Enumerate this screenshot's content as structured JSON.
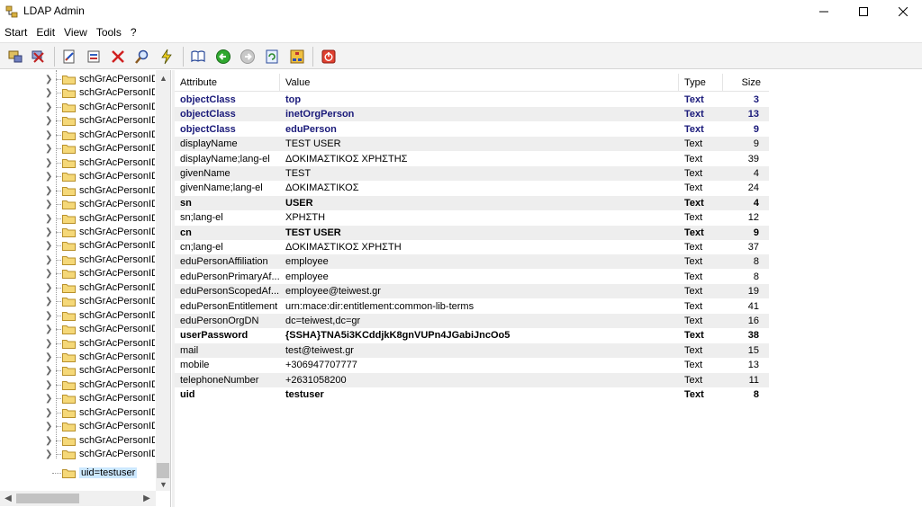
{
  "window": {
    "title": "LDAP Admin"
  },
  "menu": [
    "Start",
    "Edit",
    "View",
    "Tools",
    "?"
  ],
  "tree": {
    "items": [
      "schGrAcPersonID=",
      "schGrAcPersonID=",
      "schGrAcPersonID=",
      "schGrAcPersonID=",
      "schGrAcPersonID=",
      "schGrAcPersonID=",
      "schGrAcPersonID=",
      "schGrAcPersonID=",
      "schGrAcPersonID=",
      "schGrAcPersonID=",
      "schGrAcPersonID=",
      "schGrAcPersonID=",
      "schGrAcPersonID=",
      "schGrAcPersonID=",
      "schGrAcPersonID=",
      "schGrAcPersonID=",
      "schGrAcPersonID=",
      "schGrAcPersonID=",
      "schGrAcPersonID=",
      "schGrAcPersonID=",
      "schGrAcPersonID=",
      "schGrAcPersonID=",
      "schGrAcPersonID=",
      "schGrAcPersonID=",
      "schGrAcPersonID=",
      "schGrAcPersonID=",
      "schGrAcPersonID=",
      "schGrAcPersonID="
    ],
    "selected": "uid=testuser"
  },
  "list": {
    "headers": {
      "attribute": "Attribute",
      "value": "Value",
      "type": "Type",
      "size": "Size"
    },
    "rows": [
      {
        "attribute": "objectClass",
        "value": "top",
        "type": "Text",
        "size": "3",
        "style": "objclass"
      },
      {
        "attribute": "objectClass",
        "value": "inetOrgPerson",
        "type": "Text",
        "size": "13",
        "style": "objclass"
      },
      {
        "attribute": "objectClass",
        "value": "eduPerson",
        "type": "Text",
        "size": "9",
        "style": "objclass"
      },
      {
        "attribute": "displayName",
        "value": "TEST USER",
        "type": "Text",
        "size": "9",
        "style": ""
      },
      {
        "attribute": "displayName;lang-el",
        "value": "ΔΟΚΙΜΑΣΤΙΚΟΣ ΧΡΗΣΤΗΣ",
        "type": "Text",
        "size": "39",
        "style": ""
      },
      {
        "attribute": "givenName",
        "value": "TEST",
        "type": "Text",
        "size": "4",
        "style": ""
      },
      {
        "attribute": "givenName;lang-el",
        "value": "ΔΟΚΙΜΑΣΤΙΚΟΣ",
        "type": "Text",
        "size": "24",
        "style": ""
      },
      {
        "attribute": "sn",
        "value": "USER",
        "type": "Text",
        "size": "4",
        "style": "bold"
      },
      {
        "attribute": "sn;lang-el",
        "value": "ΧΡΗΣΤΗ",
        "type": "Text",
        "size": "12",
        "style": ""
      },
      {
        "attribute": "cn",
        "value": "TEST USER",
        "type": "Text",
        "size": "9",
        "style": "bold"
      },
      {
        "attribute": "cn;lang-el",
        "value": "ΔΟΚΙΜΑΣΤΙΚΟΣ ΧΡΗΣΤΗ",
        "type": "Text",
        "size": "37",
        "style": ""
      },
      {
        "attribute": "eduPersonAffiliation",
        "value": "employee",
        "type": "Text",
        "size": "8",
        "style": ""
      },
      {
        "attribute": "eduPersonPrimaryAf...",
        "value": "employee",
        "type": "Text",
        "size": "8",
        "style": ""
      },
      {
        "attribute": "eduPersonScopedAf...",
        "value": "employee@teiwest.gr",
        "type": "Text",
        "size": "19",
        "style": ""
      },
      {
        "attribute": "eduPersonEntitlement",
        "value": "urn:mace:dir:entitlement:common-lib-terms",
        "type": "Text",
        "size": "41",
        "style": ""
      },
      {
        "attribute": "eduPersonOrgDN",
        "value": "dc=teiwest,dc=gr",
        "type": "Text",
        "size": "16",
        "style": ""
      },
      {
        "attribute": "userPassword",
        "value": "{SSHA}TNA5i3KCddjkK8gnVUPn4JGabiJncOo5",
        "type": "Text",
        "size": "38",
        "style": "bold"
      },
      {
        "attribute": "mail",
        "value": "test@teiwest.gr",
        "type": "Text",
        "size": "15",
        "style": ""
      },
      {
        "attribute": "mobile",
        "value": "+306947707777",
        "type": "Text",
        "size": "13",
        "style": ""
      },
      {
        "attribute": "telephoneNumber",
        "value": "+2631058200",
        "type": "Text",
        "size": "11",
        "style": ""
      },
      {
        "attribute": "uid",
        "value": "testuser",
        "type": "Text",
        "size": "8",
        "style": "bold"
      }
    ]
  }
}
